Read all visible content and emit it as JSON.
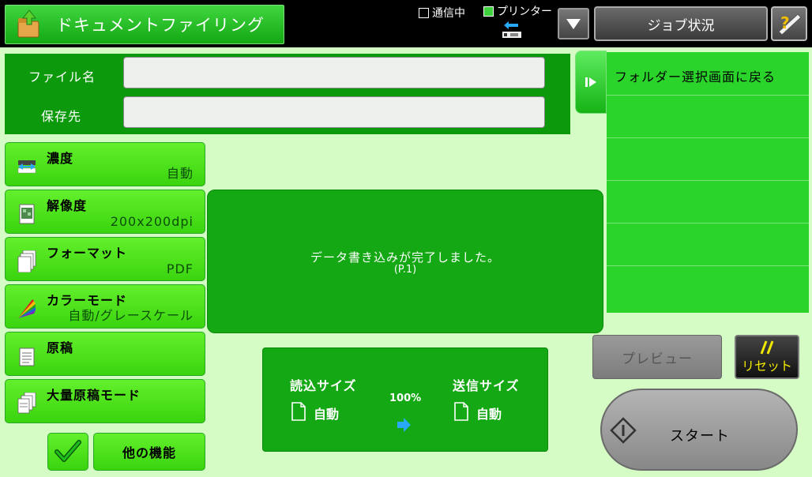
{
  "header": {
    "title": "ドキュメントファイリング",
    "status_comm": "通信中",
    "status_printer": "プリンター",
    "job_status_label": "ジョブ状況",
    "title_icon": "folder-upload-icon",
    "help_icon": "help-icon",
    "dropdown_icon": "triangle-down-icon"
  },
  "file_info": {
    "filename_label": "ファイル名",
    "filename_value": "",
    "destination_label": "保存先",
    "destination_value": ""
  },
  "settings": [
    {
      "label": "濃度",
      "value": "自動",
      "icon": "exposure-icon"
    },
    {
      "label": "解像度",
      "value": "200x200dpi",
      "icon": "resolution-icon"
    },
    {
      "label": "フォーマット",
      "value": "PDF",
      "icon": "format-icon"
    },
    {
      "label": "カラーモード",
      "value": "自動/グレースケール",
      "icon": "color-mode-icon"
    },
    {
      "label": "原稿",
      "value": "",
      "icon": "original-icon"
    },
    {
      "label": "大量原稿モード",
      "value": "",
      "icon": "job-build-icon"
    }
  ],
  "message": {
    "text": "データ書き込みが完了しました。",
    "page": "(P.1)"
  },
  "folder": {
    "back_label": "フォルダー選択画面に戻る"
  },
  "size_panel": {
    "scan_size_label": "読込サイズ",
    "scan_size_value": "自動",
    "ratio": "100%",
    "send_size_label": "送信サイズ",
    "send_size_value": "自動"
  },
  "actions": {
    "preview_label": "プレビュー",
    "reset_label": "リセット",
    "start_label": "スタート",
    "other_label": "他の機能"
  },
  "colors": {
    "accent_green": "#3ad40e",
    "panel_green": "#14a814",
    "background": "#d4fcc4",
    "reset_yellow": "#f0e800"
  }
}
